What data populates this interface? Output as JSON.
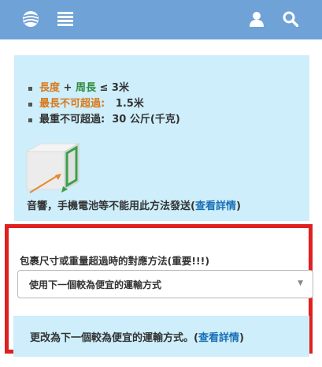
{
  "header": {
    "globe_icon": "globe-icon",
    "menu_icon": "menu-icon",
    "user_icon": "user-icon",
    "search_icon": "search-icon",
    "bg_color": "#6fa2d6"
  },
  "size_rules": {
    "rule1": {
      "length": "長度",
      "plus": " + ",
      "girth": "周長",
      "limit": " ≤ 3米"
    },
    "rule2": {
      "label": "最長不可超過:",
      "value": "1.5米"
    },
    "rule3": {
      "label": "最重不可超過:",
      "value": "30 公斤(千克)"
    },
    "battery_note": "音響，手機電池等不能用此方法發送(",
    "details_link": "查看詳情",
    "close_paren": ")"
  },
  "oversize": {
    "label": "包裹尺寸或重量超過時的對應方法(重要!!!)",
    "selected_option": "使用下一個較為便宜的運輸方式",
    "notice_text": "更改為下一個較為便宜的運輸方式。(",
    "notice_link": "查看詳情",
    "notice_close": ")"
  },
  "colors": {
    "panel_bg": "#cdeefa",
    "highlight_border": "#e02020",
    "orange": "#d9781b",
    "green": "#2e8b3d",
    "link": "#1a6fb5"
  }
}
